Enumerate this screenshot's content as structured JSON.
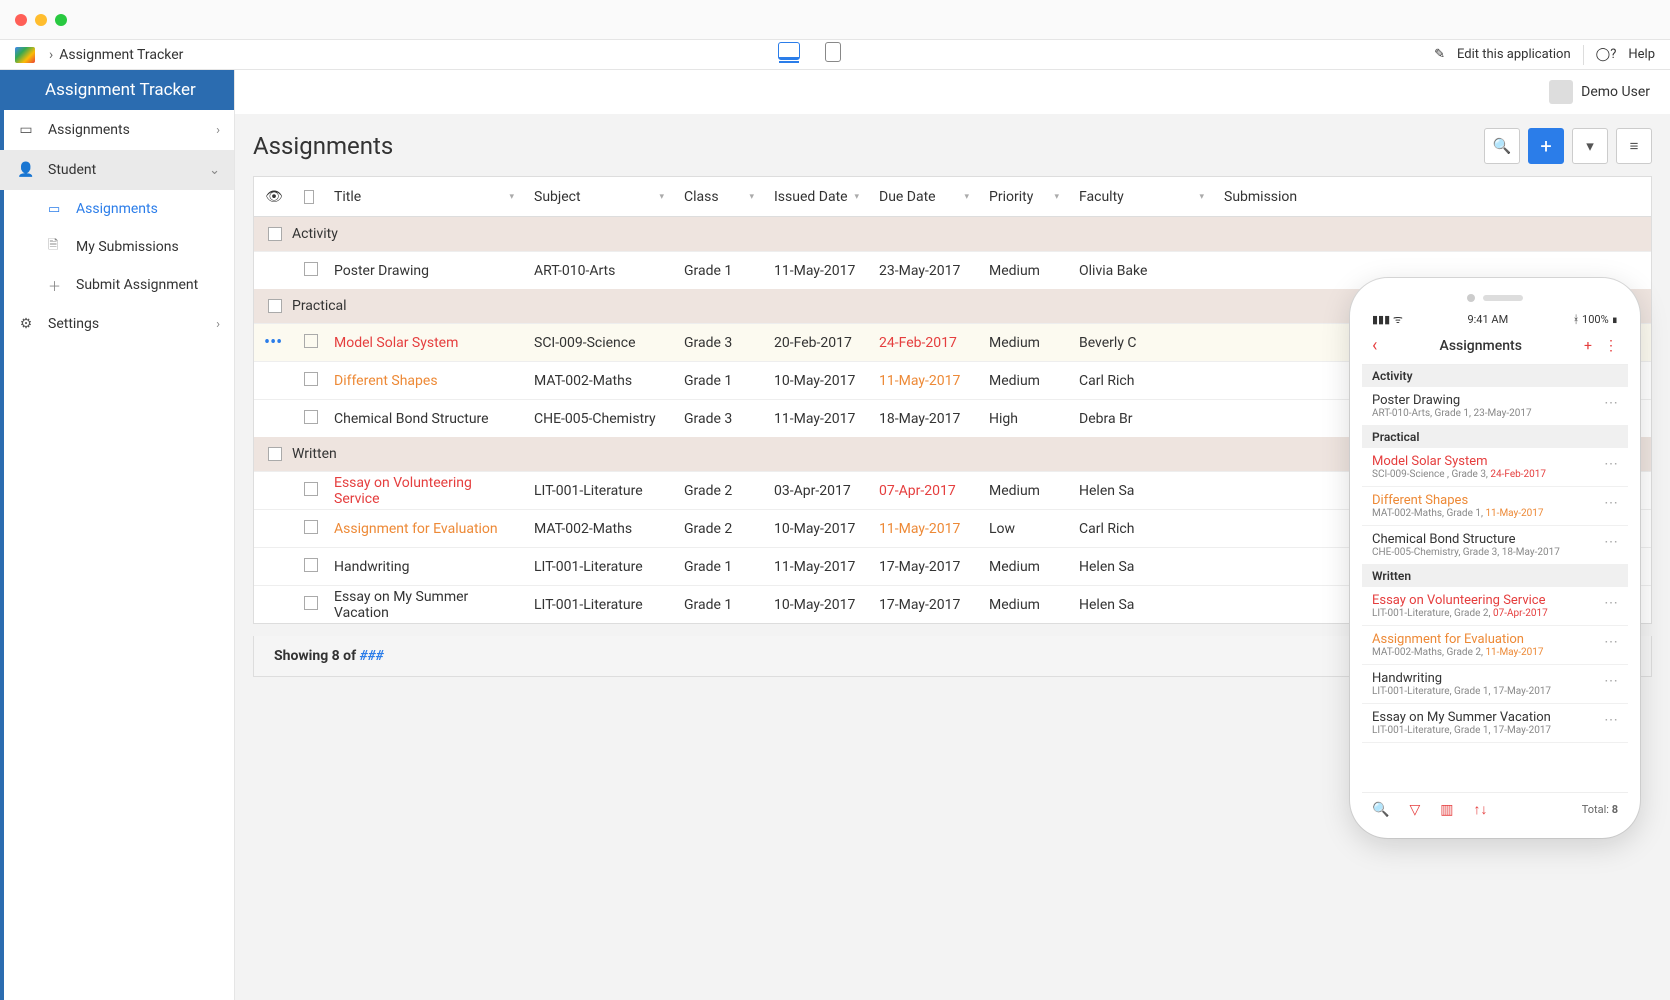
{
  "breadcrumb": {
    "app_name": "Assignment Tracker"
  },
  "top": {
    "edit": "Edit this application",
    "help": "Help"
  },
  "user": {
    "name": "Demo User"
  },
  "brand": "Assignment Tracker",
  "nav": {
    "assignments": "Assignments",
    "student": "Student",
    "sub_assignments": "Assignments",
    "sub_my_submissions": "My Submissions",
    "sub_submit": "Submit Assignment",
    "settings": "Settings"
  },
  "page": {
    "title": "Assignments"
  },
  "columns": {
    "title": "Title",
    "subject": "Subject",
    "class": "Class",
    "issued": "Issued Date",
    "due": "Due Date",
    "priority": "Priority",
    "faculty": "Faculty",
    "submission": "Submission"
  },
  "groups": {
    "activity": "Activity",
    "practical": "Practical",
    "written": "Written"
  },
  "rows": {
    "r0": {
      "title": "Poster Drawing",
      "subject": "ART-010-Arts",
      "class": "Grade 1",
      "issued": "11-May-2017",
      "due": "23-May-2017",
      "priority": "Medium",
      "faculty": "Olivia Bake"
    },
    "r1": {
      "title": "Model Solar System",
      "subject": "SCI-009-Science",
      "class": "Grade 3",
      "issued": "20-Feb-2017",
      "due": "24-Feb-2017",
      "priority": "Medium",
      "faculty": "Beverly C"
    },
    "r2": {
      "title": "Different Shapes",
      "subject": "MAT-002-Maths",
      "class": "Grade 1",
      "issued": "10-May-2017",
      "due": "11-May-2017",
      "priority": "Medium",
      "faculty": "Carl Rich"
    },
    "r3": {
      "title": "Chemical Bond Structure",
      "subject": "CHE-005-Chemistry",
      "class": "Grade 3",
      "issued": "11-May-2017",
      "due": "18-May-2017",
      "priority": "High",
      "faculty": "Debra Br"
    },
    "r4": {
      "title": "Essay on Volunteering Service",
      "subject": "LIT-001-Literature",
      "class": "Grade 2",
      "issued": "03-Apr-2017",
      "due": "07-Apr-2017",
      "priority": "Medium",
      "faculty": "Helen Sa"
    },
    "r5": {
      "title": "Assignment for Evaluation",
      "subject": "MAT-002-Maths",
      "class": "Grade 2",
      "issued": "10-May-2017",
      "due": "11-May-2017",
      "priority": "Low",
      "faculty": "Carl Rich"
    },
    "r6": {
      "title": "Handwriting",
      "subject": "LIT-001-Literature",
      "class": "Grade 1",
      "issued": "11-May-2017",
      "due": "17-May-2017",
      "priority": "Medium",
      "faculty": "Helen Sa"
    },
    "r7": {
      "title": "Essay on My Summer Vacation",
      "subject": "LIT-001-Literature",
      "class": "Grade 1",
      "issued": "10-May-2017",
      "due": "17-May-2017",
      "priority": "Medium",
      "faculty": "Helen Sa"
    }
  },
  "footer": {
    "showing": "Showing 8 of ",
    "placeholder": "###"
  },
  "phone": {
    "time": "9:41 AM",
    "battery": "100%",
    "title": "Assignments",
    "sections": {
      "activity": "Activity",
      "practical": "Practical",
      "written": "Written"
    },
    "items": {
      "p0": {
        "t": "Poster Drawing",
        "s": "ART-010-Arts, Grade 1, 23-May-2017"
      },
      "p1": {
        "t": "Model Solar System",
        "s": "SCI-009-Science , Grade 3,  ",
        "d": "24-Feb-2017"
      },
      "p2": {
        "t": "Different Shapes",
        "s": "MAT-002-Maths, Grade 1,  ",
        "d": "11-May-2017"
      },
      "p3": {
        "t": "Chemical Bond Structure",
        "s": "CHE-005-Chemistry, Grade 3, 18-May-2017"
      },
      "p4": {
        "t": "Essay on Volunteering Service",
        "s": "LIT-001-Literature, Grade 2,  ",
        "d": "07-Apr-2017"
      },
      "p5": {
        "t": "Assignment for Evaluation",
        "s": "MAT-002-Maths, Grade 2,  ",
        "d": "11-May-2017"
      },
      "p6": {
        "t": "Handwriting",
        "s": "LIT-001-Literature, Grade 1, 17-May-2017"
      },
      "p7": {
        "t": "Essay on My Summer Vacation",
        "s": "LIT-001-Literature, Grade 1, 17-May-2017"
      }
    },
    "total_label": "Total: ",
    "total": "8"
  }
}
